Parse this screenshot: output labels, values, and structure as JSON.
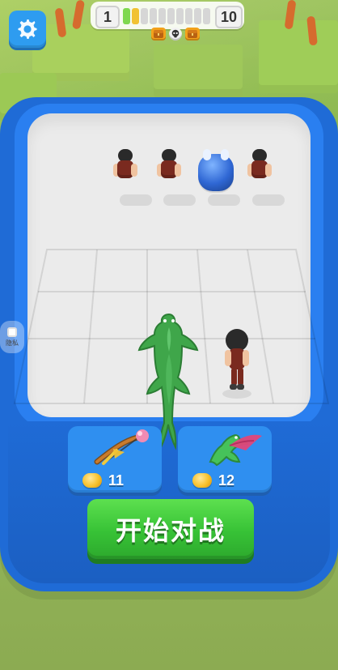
{
  "hud": {
    "level_start": "1",
    "level_end": "10",
    "progress": {
      "segments_total": 10,
      "segments_filled": 2
    },
    "milestones": [
      {
        "type": "chest-icon"
      },
      {
        "type": "skull-icon"
      },
      {
        "type": "chest-icon"
      }
    ]
  },
  "side_panel": {
    "label": "隐私"
  },
  "shop": {
    "cards": [
      {
        "price": "11",
        "icon": "bow-icon"
      },
      {
        "price": "12",
        "icon": "dragon-icon"
      }
    ],
    "start_button_label": "开始对战"
  },
  "colors": {
    "arena_blue": "#1f6bd6",
    "button_green": "#37c236",
    "card_blue": "#2f8ff0",
    "gold": "#f7c12c"
  }
}
